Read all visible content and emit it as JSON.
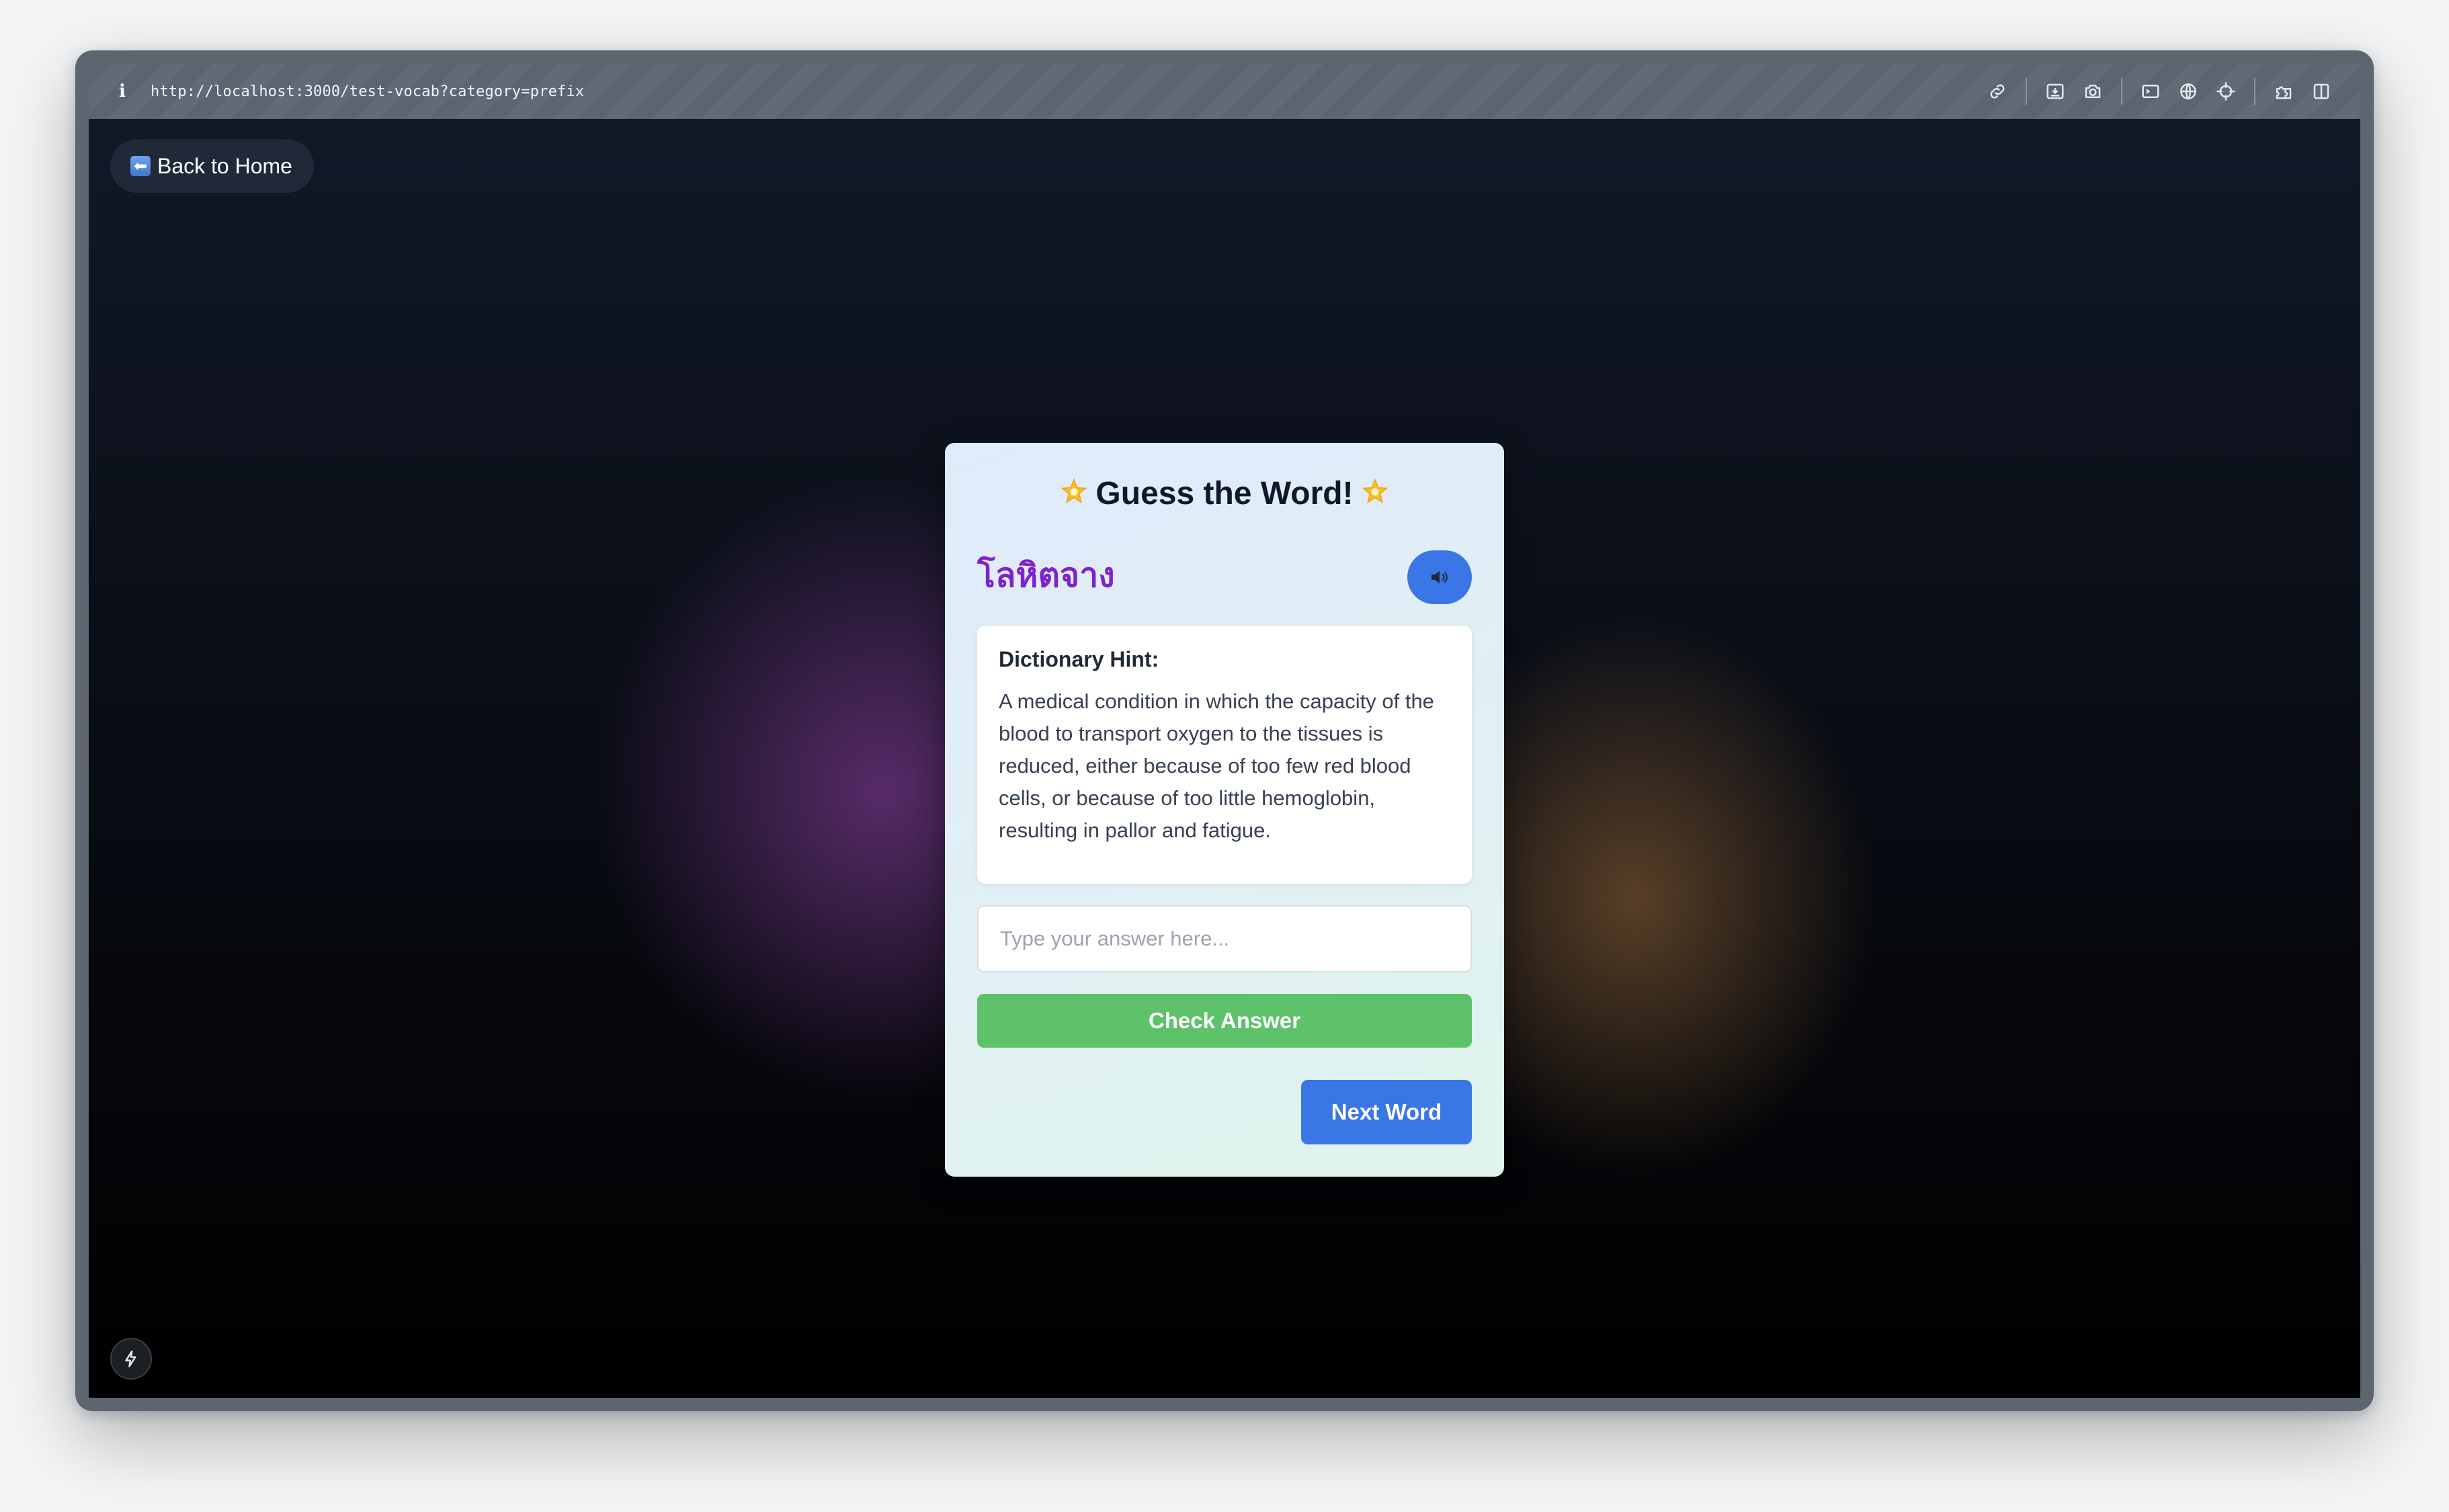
{
  "browser": {
    "url": "http://localhost:3000/test-vocab?category=prefix",
    "info_icon_glyph": "i",
    "toolbar_icons": [
      "link-icon",
      "screenshot-save-icon",
      "camera-icon",
      "terminal-icon",
      "globe-icon",
      "crosshair-icon",
      "extensions-icon",
      "split-view-icon"
    ]
  },
  "page": {
    "back_button": {
      "icon": "back-arrow-icon",
      "arrow_glyph": "⬅",
      "label": "Back to Home"
    },
    "card": {
      "title": "Guess the Word!",
      "title_icon": "star-icon",
      "word": "โลหิตจาง",
      "speak_icon": "speaker-icon",
      "hint_title": "Dictionary Hint:",
      "hint_text": "A medical condition in which the capacity of the blood to transport oxygen to the tissues is reduced, either because of too few red blood cells, or because of too little hemoglobin, resulting in pallor and fatigue.",
      "answer_value": "",
      "answer_placeholder": "Type your answer here...",
      "check_button_label": "Check Answer",
      "next_button_label": "Next Word"
    },
    "dev_badge_icon": "lightning-icon"
  },
  "colors": {
    "word": "#7e22ce",
    "primary_button": "#3b76e6",
    "check_button": "#5ec26a",
    "back_button_bg": "#1f2937"
  }
}
